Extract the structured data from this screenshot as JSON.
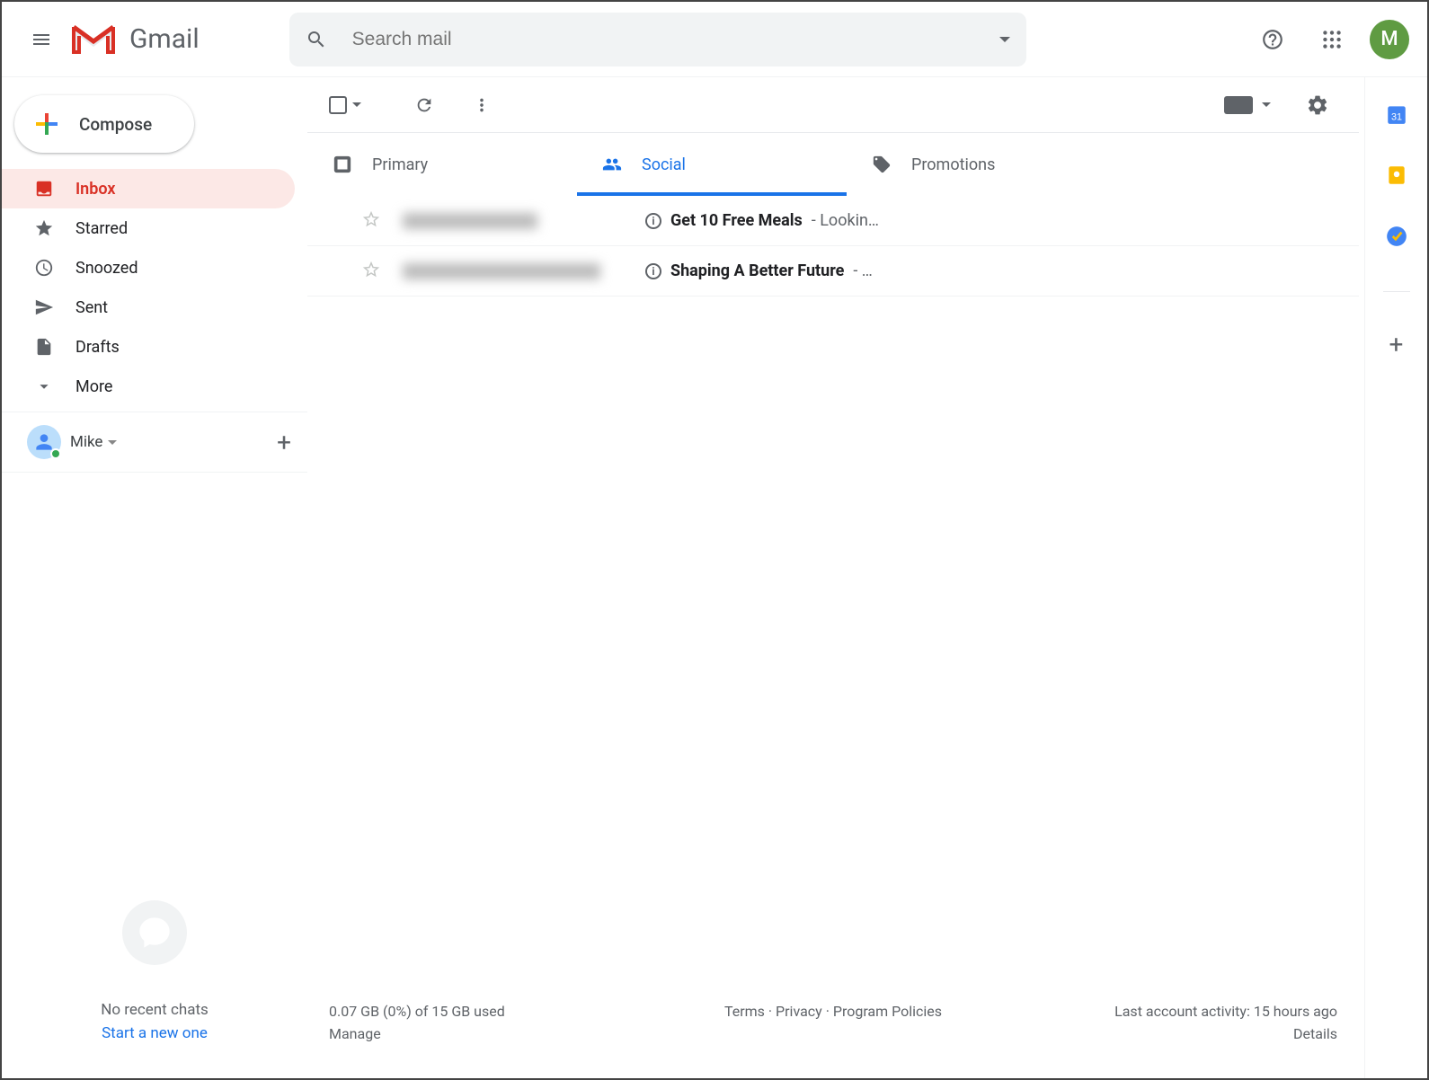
{
  "header": {
    "app_name": "Gmail",
    "search_placeholder": "Search mail",
    "avatar_initial": "M"
  },
  "sidebar": {
    "compose_label": "Compose",
    "items": [
      {
        "label": "Inbox"
      },
      {
        "label": "Starred"
      },
      {
        "label": "Snoozed"
      },
      {
        "label": "Sent"
      },
      {
        "label": "Drafts"
      },
      {
        "label": "More"
      }
    ],
    "hangouts_user": "Mike",
    "no_chats": "No recent chats",
    "start_new": "Start a new one"
  },
  "tabs": [
    {
      "label": "Primary"
    },
    {
      "label": "Social"
    },
    {
      "label": "Promotions"
    }
  ],
  "emails": [
    {
      "subject": "Get 10 Free Meals",
      "snippet": " - Lookin…"
    },
    {
      "subject": "Shaping A Better Future",
      "snippet": " - …"
    }
  ],
  "footer": {
    "storage": "0.07 GB (0%) of 15 GB used",
    "manage": "Manage",
    "links": "Terms · Privacy · Program Policies",
    "activity": "Last account activity: 15 hours ago",
    "details": "Details"
  }
}
